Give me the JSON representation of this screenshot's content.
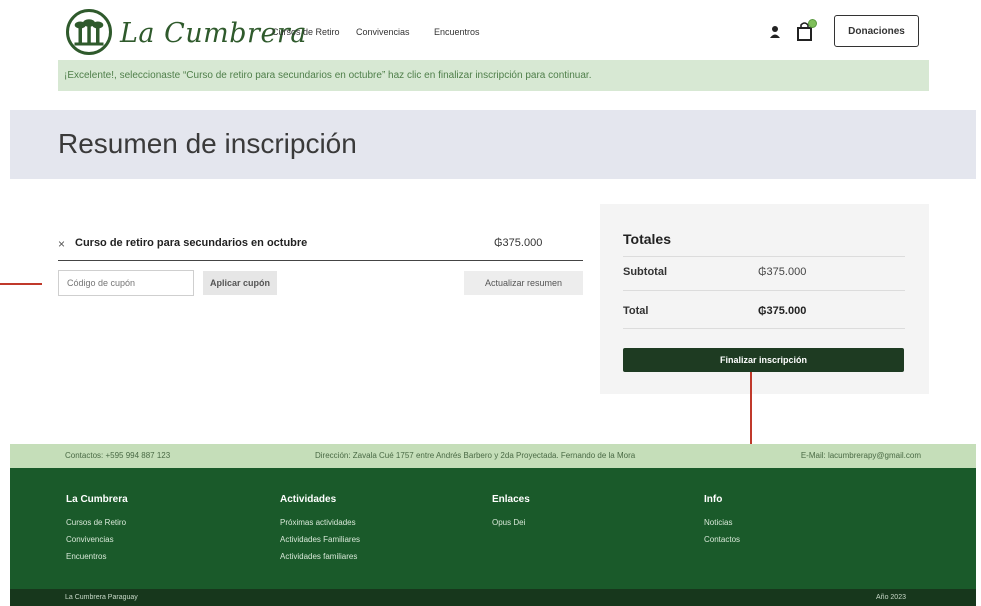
{
  "header": {
    "logo_text": "La Cumbrera",
    "nav": [
      "Cursos de Retiro",
      "Convivencias",
      "Encuentros"
    ],
    "user_icon": "user-icon",
    "cart_icon": "cart-icon",
    "donate_label": "Donaciones"
  },
  "notice": {
    "text": "¡Excelente!, seleccionaste “Curso de retiro para secundarios en octubre” haz clic en finalizar inscripción para continuar."
  },
  "page_title": "Resumen de inscripción",
  "cart": {
    "remove_symbol": "×",
    "item_name": "Curso de retiro para secundarios en octubre",
    "item_price": "₲375.000",
    "coupon_placeholder": "Código de cupón",
    "apply_coupon": "Aplicar cupón",
    "update_summary": "Actualizar resumen"
  },
  "totals": {
    "title": "Totales",
    "subtotal_label": "Subtotal",
    "subtotal_value": "₲375.000",
    "total_label": "Total",
    "total_value": "₲375.000",
    "checkout_label": "Finalizar inscripción"
  },
  "footer": {
    "contact": "Contactos: +595 994 887 123",
    "address": "Dirección: Zavala Cué 1757 entre Andrés Barbero y 2da Proyectada. Fernando de la Mora",
    "email": "E-Mail: lacumbrerapy@gmail.com",
    "columns": [
      {
        "title": "La Cumbrera",
        "links": [
          "Cursos de Retiro",
          "Convivencias",
          "Encuentros"
        ]
      },
      {
        "title": "Actividades",
        "links": [
          "Próximas actividades",
          "Actividades Familiares",
          "Actividades familiares"
        ]
      },
      {
        "title": "Enlaces",
        "links": [
          "Opus Dei"
        ]
      },
      {
        "title": "Info",
        "links": [
          "Noticias",
          "Contactos"
        ]
      }
    ],
    "bottom_left": "La Cumbrera Paraguay",
    "bottom_right": "Año 2023"
  },
  "colors": {
    "brand_green": "#2f5a2c",
    "notice_bg": "#d7e8d3",
    "checkout_bg": "#1e3b22",
    "footer_bg": "#1a5a2a",
    "pointer_red": "#c0392b"
  }
}
